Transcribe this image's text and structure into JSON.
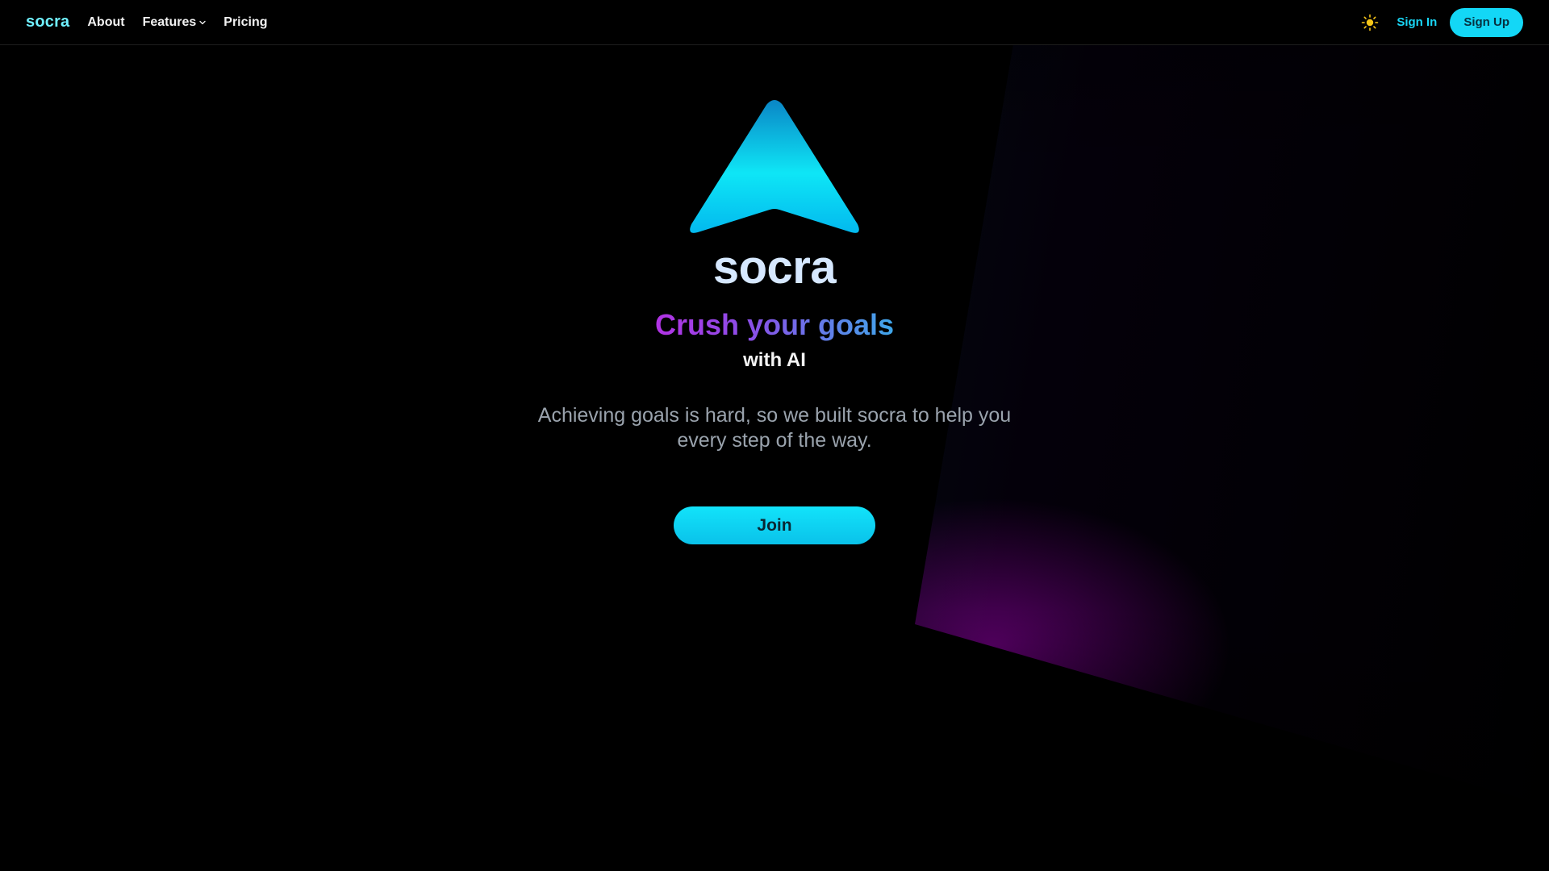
{
  "nav": {
    "brand": "socra",
    "links": [
      {
        "label": "About"
      },
      {
        "label": "Features",
        "has_dropdown": true,
        "icon": "chevron-down-icon"
      },
      {
        "label": "Pricing"
      }
    ],
    "theme_toggle_icon": "sun-icon",
    "sign_in_label": "Sign In",
    "sign_up_label": "Sign Up"
  },
  "hero": {
    "logo_icon": "arrow-up-logo-icon",
    "brand": "socra",
    "headline": "Crush your goals",
    "subheadline": "with AI",
    "description": "Achieving goals is hard, so we built socra to help you every step of the way.",
    "cta_label": "Join"
  },
  "colors": {
    "accent": "#13d7f6",
    "brand_text": "#6ff0ff",
    "headline_gradient_start": "#b233e4",
    "headline_gradient_end": "#3fa7ea",
    "background": "#000000"
  }
}
